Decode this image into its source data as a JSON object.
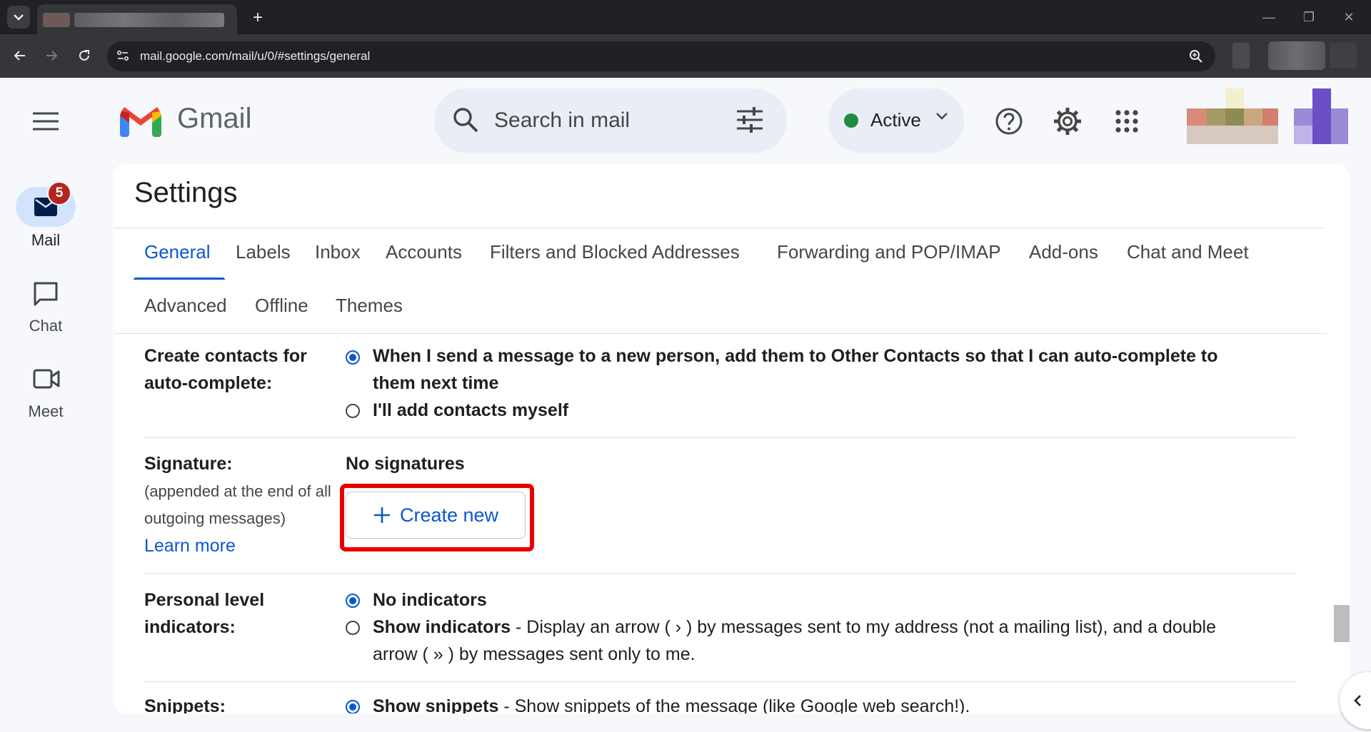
{
  "browser": {
    "url": "mail.google.com/mail/u/0/#settings/general",
    "new_tab": "+",
    "minimize": "—",
    "restore": "❐",
    "close": "✕"
  },
  "header": {
    "brand": "Gmail",
    "search_placeholder": "Search in mail",
    "status_label": "Active",
    "status_color": "#1e8e3e"
  },
  "rail": {
    "items": [
      {
        "label": "Mail",
        "badge": "5"
      },
      {
        "label": "Chat"
      },
      {
        "label": "Meet"
      }
    ]
  },
  "settings": {
    "title": "Settings",
    "tabs_row1": [
      "General",
      "Labels",
      "Inbox",
      "Accounts",
      "Filters and Blocked Addresses",
      "Forwarding and POP/IMAP",
      "Add-ons",
      "Chat and Meet"
    ],
    "tabs_row2": [
      "Advanced",
      "Offline",
      "Themes"
    ],
    "contacts": {
      "label_line1": "Create contacts for",
      "label_line2": "auto-complete:",
      "option1_line1": "When I send a message to a new person, add them to Other Contacts so that I can auto-complete to",
      "option1_line2": "them next time",
      "option2": "I'll add contacts myself"
    },
    "signature": {
      "label": "Signature:",
      "sub_line1": "(appended at the end of all",
      "sub_line2": "outgoing messages)",
      "learn_more": "Learn more",
      "none_text": "No signatures",
      "create_button": "Create new"
    },
    "indicators": {
      "label_line1": "Personal level",
      "label_line2": "indicators:",
      "option1": "No indicators",
      "option2_bold": "Show indicators",
      "option2_rest": " - Display an arrow ( › ) by messages sent to my address (not a mailing list), and a double",
      "option2_line2": "arrow ( » ) by messages sent only to me."
    },
    "snippets": {
      "label": "Snippets:",
      "option1_bold": "Show snippets",
      "option1_rest": " - Show snippets of the message (like Google web search!)."
    }
  },
  "accent_color": "#0b57d0",
  "highlight_color": "#e60000"
}
